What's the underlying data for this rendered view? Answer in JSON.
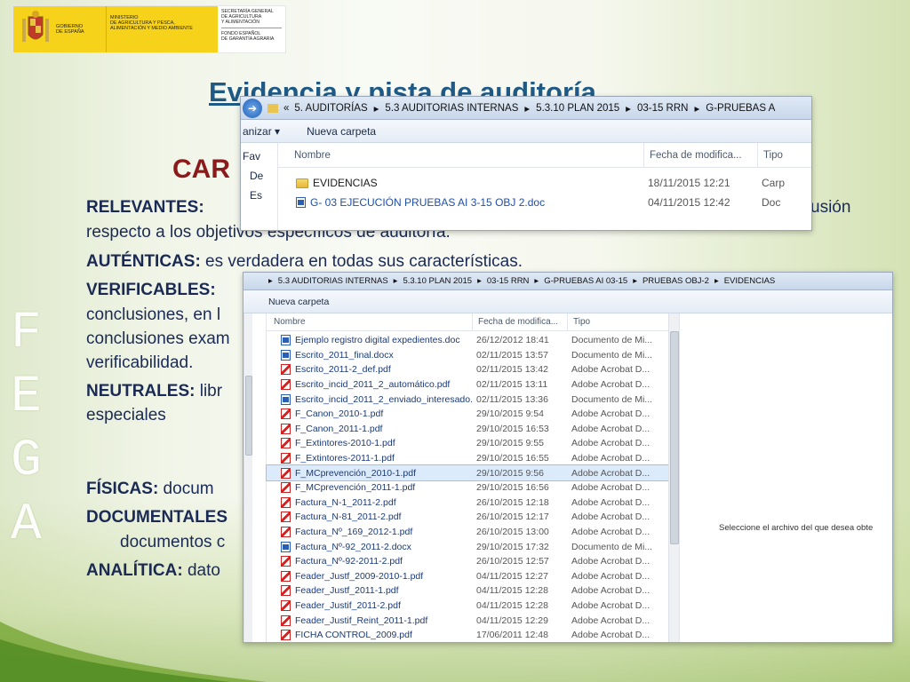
{
  "header": {
    "gobierno": [
      "GOBIERNO",
      "DE ESPAÑA"
    ],
    "ministerio": [
      "MINISTERIO",
      "DE AGRICULTURA Y PESCA,",
      "ALIMENTACIÓN Y MEDIO AMBIENTE"
    ],
    "secretaria": [
      "SECRETARÍA GENERAL",
      "DE AGRICULTURA",
      "Y ALIMENTACIÓN"
    ],
    "fondo": [
      "FONDO ESPAÑOL",
      "DE GARANTÍA AGRARIA"
    ]
  },
  "slide": {
    "title": "Evidencia y pista de auditoría",
    "subtitle_visible": "CAR",
    "relevantes_label": "RELEVANTES:",
    "relevantes_tail": "usión",
    "relevantes_line2": "respecto a los objetivos específicos de auditoría.",
    "autenticas_label": "AUTÉNTICAS:",
    "autenticas_text": " es verdadera en todas sus características.",
    "verificables_label": "VERIFICABLES:",
    "verificables_l2": "conclusiones, en l",
    "verificables_l3": "conclusiones exam",
    "verificables_l4": "verificabilidad.",
    "neutrales_label": "NEUTRALES:",
    "neutrales_text": " libr",
    "neutrales_l2": "especiales",
    "fisicas_label": "FÍSICAS:",
    "fisicas_text": "  docum",
    "documentales_label": "DOCUMENTALES",
    "documentales_l2": "documentos c",
    "analitica_label": "ANALÍTICA:",
    "analitica_text": " dato",
    "fega": [
      "F",
      "E",
      "G",
      "A"
    ]
  },
  "window1": {
    "breadcrumb": [
      "5. AUDITORÍAS",
      "5.3 AUDITORIAS INTERNAS",
      "5.3.10 PLAN 2015",
      "03-15 RRN",
      "G-PRUEBAS A"
    ],
    "organize_label": "anizar",
    "new_folder": "Nueva carpeta",
    "nav": [
      "Fav",
      "De",
      "Es"
    ],
    "columns": {
      "name": "Nombre",
      "date": "Fecha de modifica...",
      "type": "Tipo"
    },
    "rows": [
      {
        "name": "EVIDENCIAS",
        "date": "18/11/2015 12:21",
        "type": "Carp",
        "icon": "folder-icon"
      },
      {
        "name": "G- 03 EJECUCIÓN PRUEBAS AI 3-15 OBJ 2.doc",
        "date": "04/11/2015 12:42",
        "type": "Doc",
        "icon": "word-doc-icon"
      }
    ]
  },
  "window2": {
    "breadcrumb": [
      "5.3 AUDITORIAS INTERNAS",
      "5.3.10 PLAN 2015",
      "03-15 RRN",
      "G-PRUEBAS AI 03-15",
      "PRUEBAS OBJ-2",
      "EVIDENCIAS"
    ],
    "new_folder": "Nueva carpeta",
    "columns": {
      "name": "Nombre",
      "date": "Fecha de modifica...",
      "type": "Tipo"
    },
    "preview_text": "Seleccione el archivo del que desea obte",
    "rows": [
      {
        "name": "Ejemplo registro digital expedientes.doc",
        "date": "26/12/2012 18:41",
        "type": "Documento de Mi...",
        "icon": "doc"
      },
      {
        "name": "Escrito_2011_final.docx",
        "date": "02/11/2015 13:57",
        "type": "Documento de Mi...",
        "icon": "doc"
      },
      {
        "name": "Escrito_2011-2_def.pdf",
        "date": "02/11/2015 13:42",
        "type": "Adobe Acrobat D...",
        "icon": "pdf"
      },
      {
        "name": "Escrito_incid_2011_2_automático.pdf",
        "date": "02/11/2015 13:11",
        "type": "Adobe Acrobat D...",
        "icon": "pdf"
      },
      {
        "name": "Escrito_incid_2011_2_enviado_interesado....",
        "date": "02/11/2015 13:36",
        "type": "Documento de Mi...",
        "icon": "doc"
      },
      {
        "name": "F_Canon_2010-1.pdf",
        "date": "29/10/2015 9:54",
        "type": "Adobe Acrobat D...",
        "icon": "pdf"
      },
      {
        "name": "F_Canon_2011-1.pdf",
        "date": "29/10/2015 16:53",
        "type": "Adobe Acrobat D...",
        "icon": "pdf"
      },
      {
        "name": "F_Extintores-2010-1.pdf",
        "date": "29/10/2015 9:55",
        "type": "Adobe Acrobat D...",
        "icon": "pdf"
      },
      {
        "name": "F_Extintores-2011-1.pdf",
        "date": "29/10/2015 16:55",
        "type": "Adobe Acrobat D...",
        "icon": "pdf"
      },
      {
        "name": "F_MCprevención_2010-1.pdf",
        "date": "29/10/2015 9:56",
        "type": "Adobe Acrobat D...",
        "icon": "pdf"
      },
      {
        "name": "F_MCprevención_2011-1.pdf",
        "date": "29/10/2015 16:56",
        "type": "Adobe Acrobat D...",
        "icon": "pdf"
      },
      {
        "name": "Factura_N-1_2011-2.pdf",
        "date": "26/10/2015 12:18",
        "type": "Adobe Acrobat D...",
        "icon": "pdf"
      },
      {
        "name": "Factura_N-81_2011-2.pdf",
        "date": "26/10/2015 12:17",
        "type": "Adobe Acrobat D...",
        "icon": "pdf"
      },
      {
        "name": "Factura_Nº_169_2012-1.pdf",
        "date": "26/10/2015 13:00",
        "type": "Adobe Acrobat D...",
        "icon": "pdf"
      },
      {
        "name": "Factura_Nº-92_2011-2.docx",
        "date": "29/10/2015 17:32",
        "type": "Documento de Mi...",
        "icon": "doc"
      },
      {
        "name": "Factura_Nº-92-2011-2.pdf",
        "date": "26/10/2015 12:57",
        "type": "Adobe Acrobat D...",
        "icon": "pdf"
      },
      {
        "name": "Feader_Justf_2009-2010-1.pdf",
        "date": "04/11/2015 12:27",
        "type": "Adobe Acrobat D...",
        "icon": "pdf"
      },
      {
        "name": "Feader_Justf_2011-1.pdf",
        "date": "04/11/2015 12:28",
        "type": "Adobe Acrobat D...",
        "icon": "pdf"
      },
      {
        "name": "Feader_Justif_2011-2.pdf",
        "date": "04/11/2015 12:28",
        "type": "Adobe Acrobat D...",
        "icon": "pdf"
      },
      {
        "name": "Feader_Justif_Reint_2011-1.pdf",
        "date": "04/11/2015 12:29",
        "type": "Adobe Acrobat D...",
        "icon": "pdf"
      },
      {
        "name": "FICHA CONTROL_2009.pdf",
        "date": "17/06/2011 12:48",
        "type": "Adobe Acrobat D...",
        "icon": "pdf"
      }
    ]
  }
}
